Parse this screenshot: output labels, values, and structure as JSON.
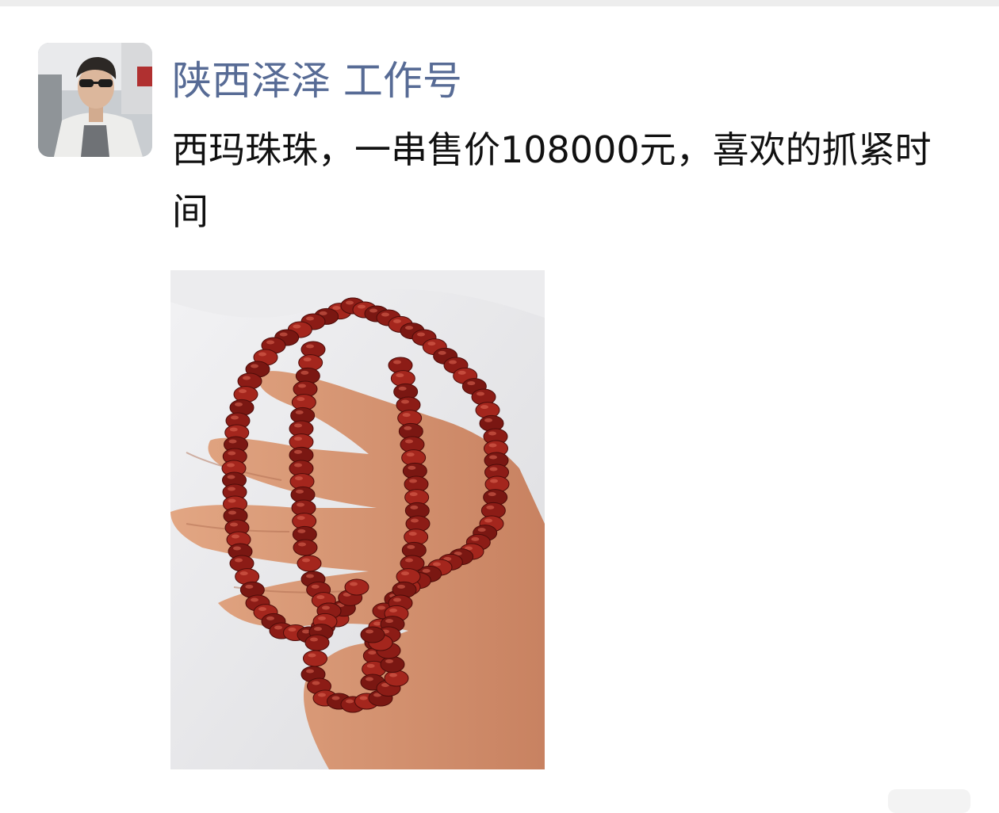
{
  "post": {
    "author": "陕西泽泽 工作号",
    "text": "西玛珠珠，一串售价108000元，喜欢的抓紧时间"
  },
  "colors": {
    "author_link": "#576b95",
    "text": "#111111",
    "background": "#ffffff",
    "top_strip": "#ededed"
  },
  "image": {
    "subject": "beaded-necklace-photo"
  }
}
